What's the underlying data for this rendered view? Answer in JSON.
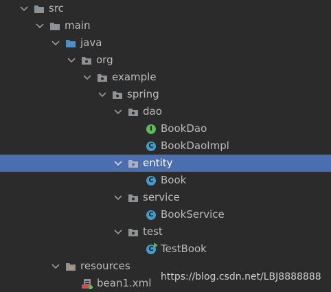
{
  "colors": {
    "background": "#2b2b2b",
    "selection": "#4b6eaf",
    "folder": "#8c9296",
    "source_folder": "#4f8fc6",
    "class_icon": "#3f9dcc",
    "interface_icon": "#5fb85f"
  },
  "tree": [
    {
      "label": "src",
      "icon": "folder-icon",
      "expanded": true
    },
    {
      "label": "main",
      "icon": "folder-icon",
      "expanded": true
    },
    {
      "label": "java",
      "icon": "source-folder-icon",
      "expanded": true
    },
    {
      "label": "org",
      "icon": "package-icon",
      "expanded": true
    },
    {
      "label": "example",
      "icon": "package-icon",
      "expanded": true
    },
    {
      "label": "spring",
      "icon": "package-icon",
      "expanded": true
    },
    {
      "label": "dao",
      "icon": "package-icon",
      "expanded": true
    },
    {
      "label": "BookDao",
      "icon": "interface-icon",
      "badge": "I"
    },
    {
      "label": "BookDaoImpl",
      "icon": "class-icon",
      "badge": "C"
    },
    {
      "label": "entity",
      "icon": "package-icon",
      "expanded": true,
      "selected": true
    },
    {
      "label": "Book",
      "icon": "class-icon",
      "badge": "C"
    },
    {
      "label": "service",
      "icon": "package-icon",
      "expanded": true
    },
    {
      "label": "BookService",
      "icon": "class-icon",
      "badge": "C"
    },
    {
      "label": "test",
      "icon": "package-icon",
      "expanded": true
    },
    {
      "label": "TestBook",
      "icon": "runnable-class-icon",
      "badge": "C"
    },
    {
      "label": "resources",
      "icon": "resources-folder-icon",
      "expanded": true
    },
    {
      "label": "bean1.xml",
      "icon": "xml-file-icon"
    }
  ],
  "watermark": "https://blog.csdn.net/LBJ8888888"
}
